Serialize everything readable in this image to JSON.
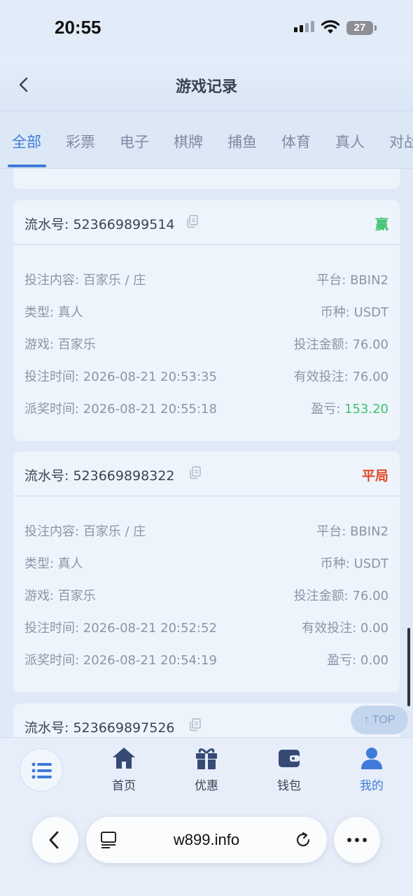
{
  "status": {
    "time": "20:55",
    "battery": "27"
  },
  "header": {
    "title": "游戏记录"
  },
  "tabs": [
    "全部",
    "彩票",
    "电子",
    "棋牌",
    "捕鱼",
    "体育",
    "真人",
    "对战"
  ],
  "records": [
    {
      "serial": "流水号: 523669899514",
      "result": "赢",
      "content": "投注内容: 百家乐 / 庄",
      "platform": "平台: BBIN2",
      "type": "类型: 真人",
      "currency": "币种: USDT",
      "game": "游戏: 百家乐",
      "bet_amount": "投注金额: 76.00",
      "bet_time": "投注时间: 2026-08-21 20:53:35",
      "valid_bet": "有效投注: 76.00",
      "payout_time": "派奖时间: 2026-08-21 20:55:18",
      "profit_label": "盈亏: ",
      "profit_value": "153.20"
    },
    {
      "serial": "流水号: 523669898322",
      "result": "平局",
      "content": "投注内容: 百家乐 / 庄",
      "platform": "平台: BBIN2",
      "type": "类型: 真人",
      "currency": "币种: USDT",
      "game": "游戏: 百家乐",
      "bet_amount": "投注金额: 76.00",
      "bet_time": "投注时间: 2026-08-21 20:52:52",
      "valid_bet": "有效投注: 0.00",
      "payout_time": "派奖时间: 2026-08-21 20:54:19",
      "profit_label": "盈亏: ",
      "profit_value": "0.00"
    },
    {
      "serial": "流水号: 523669897526"
    }
  ],
  "top_button": "↑ TOP",
  "bottom_nav": [
    "首页",
    "优惠",
    "钱包",
    "我的"
  ],
  "browser": {
    "url": "w899.info"
  },
  "colors": {
    "accent": "#3f7bd8",
    "win": "#3ec36e",
    "draw": "#e04a2a"
  }
}
